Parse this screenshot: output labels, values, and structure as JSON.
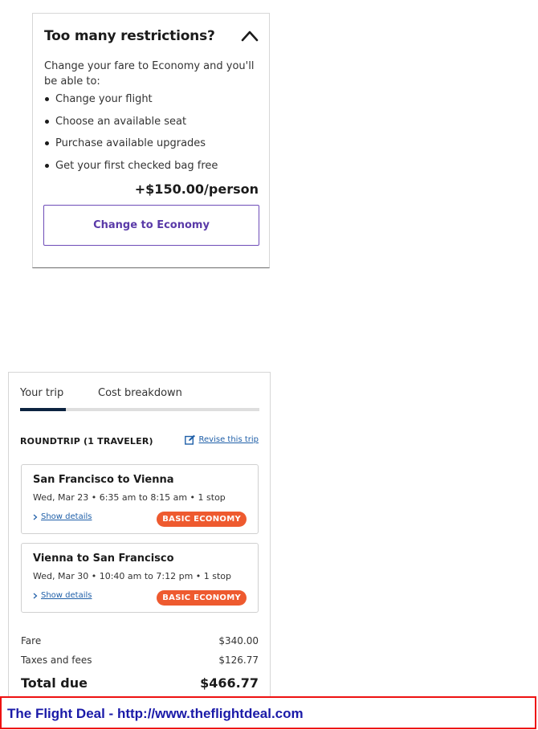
{
  "upsell": {
    "title": "Too many restrictions?",
    "description": "Change your fare to Economy and you'll be able to:",
    "benefits": [
      "Change your flight",
      "Choose an available seat",
      "Purchase available upgrades",
      "Get your first checked bag free"
    ],
    "price": "+$150.00/person",
    "button_label": "Change to Economy"
  },
  "summary": {
    "tabs": [
      "Your trip",
      "Cost breakdown"
    ],
    "active_tab": "Your trip",
    "trip_type": "ROUNDTRIP (1 TRAVELER)",
    "revise_link": "Revise this trip",
    "flights": [
      {
        "route": "San Francisco to Vienna",
        "times": "Wed, Mar 23 • 6:35 am to 8:15 am • 1 stop",
        "details_link": "Show details",
        "fare_badge": "BASIC ECONOMY"
      },
      {
        "route": "Vienna to San Francisco",
        "times": "Wed, Mar 30 • 10:40 am to 7:12 pm • 1 stop",
        "details_link": "Show details",
        "fare_badge": "BASIC ECONOMY"
      }
    ],
    "costs": {
      "fare_label": "Fare",
      "fare_amount": "$340.00",
      "taxes_label": "Taxes and fees",
      "taxes_amount": "$126.77",
      "total_label": "Total due",
      "total_amount": "$466.77"
    }
  },
  "banner": {
    "text": "The Flight Deal - http://www.theflightdeal.com"
  },
  "colors": {
    "accent_purple": "#5a3aa8",
    "badge_orange": "#ee5a2f",
    "link_blue": "#1f5fa8",
    "tab_active": "#0c2340",
    "banner_border": "#ee1111",
    "banner_text": "#1a1aa8"
  },
  "icons": {
    "collapse": "chevron-up-icon",
    "revise": "edit-icon",
    "details": "chevron-right-icon"
  }
}
